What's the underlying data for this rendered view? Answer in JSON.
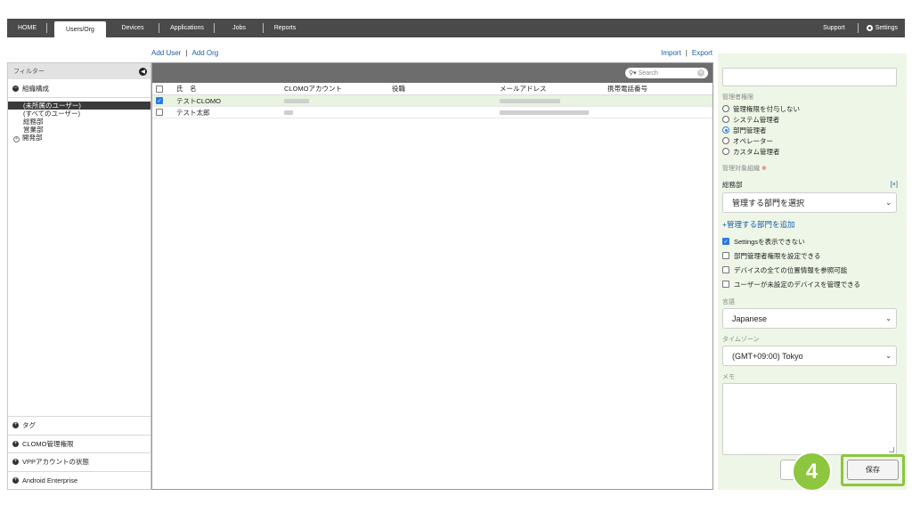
{
  "nav": {
    "tabs": [
      "HOME",
      "Users/Org",
      "Devices",
      "Applications",
      "Jobs",
      "Reports"
    ],
    "support": "Support",
    "settings": "Settings"
  },
  "actions": {
    "add_user": "Add User",
    "add_org": "Add Org",
    "import": "Import",
    "export": "Export",
    "separator": "|"
  },
  "filter": {
    "title": "フィルター",
    "org_section": "組織構成",
    "tree": [
      "(未所属のユーザー)",
      "(すべてのユーザー)",
      "総務部",
      "営業部",
      "開発部"
    ],
    "tag": "タグ",
    "clomo_perm": "CLOMO管理権限",
    "vpp": "VPPアカウントの状態",
    "android": "Android Enterprise"
  },
  "table": {
    "search_placeholder": "Search",
    "headers": [
      "氏　名",
      "CLOMOアカウント",
      "役職",
      "メールアドレス",
      "携帯電話番号"
    ],
    "rows": [
      {
        "name": "テストCLOMO",
        "checked": true
      },
      {
        "name": "テスト太郎",
        "checked": false
      }
    ]
  },
  "panel": {
    "admin_perm_label": "管理者権限",
    "admin_options": [
      "管理権限を付与しない",
      "システム管理者",
      "部門管理者",
      "オペレーター",
      "カスタム管理者"
    ],
    "admin_selected_index": 2,
    "target_org_label": "管理対象組織",
    "required_mark": "※",
    "org_name": "総務部",
    "remove": "[×]",
    "select_dept": "管理する部門を選択",
    "add_dept": "+管理する部門を追加",
    "checks": [
      {
        "label": "Settingsを表示できない",
        "on": true
      },
      {
        "label": "部門管理者権限を設定できる",
        "on": false
      },
      {
        "label": "デバイスの全ての位置情報を参照可能",
        "on": false
      },
      {
        "label": "ユーザーが未設定のデバイスを管理できる",
        "on": false
      }
    ],
    "language_label": "言語",
    "language_value": "Japanese",
    "timezone_label": "タイムゾーン",
    "timezone_value": "(GMT+09:00) Tokyo",
    "memo_label": "メモ",
    "save": "保存",
    "step_number": "4"
  },
  "colors": {
    "nav_bg": "#4a4a4a",
    "accent_green": "#8dc63f",
    "link_blue": "#1a5ea8",
    "panel_bg": "#eef6e7"
  }
}
